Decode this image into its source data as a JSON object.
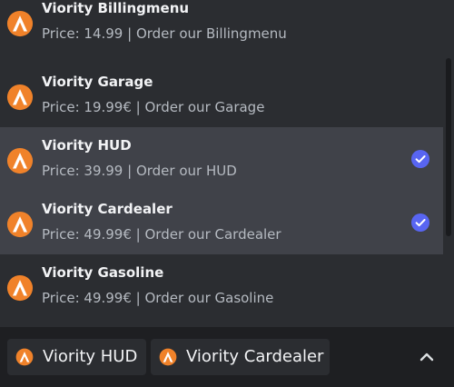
{
  "options": [
    {
      "name": "Viority Billingmenu",
      "description": "Price: 14.99 | Order our Billingmenu",
      "selected": false,
      "icon": "viority-logo-icon"
    },
    {
      "name": "Viority Garage",
      "description": "Price: 19.99€ | Order our Garage",
      "selected": false,
      "icon": "viority-logo-icon"
    },
    {
      "name": "Viority HUD",
      "description": "Price: 39.99 | Order our HUD",
      "selected": true,
      "icon": "viority-logo-icon"
    },
    {
      "name": "Viority Cardealer",
      "description": "Price: 49.99€ | Order our Cardealer",
      "selected": true,
      "icon": "viority-logo-icon"
    },
    {
      "name": "Viority Gasoline",
      "description": "Price: 49.99€ | Order our Gasoline",
      "selected": false,
      "icon": "viority-logo-icon"
    }
  ],
  "selected_chips": [
    {
      "label": "Viority HUD",
      "icon": "viority-logo-icon"
    },
    {
      "label": "Viority Cardealer",
      "icon": "viority-logo-icon"
    }
  ],
  "icons": {
    "logo": "viority-logo-icon",
    "check": "check-circle-icon",
    "caret": "chevron-up-icon"
  },
  "colors": {
    "background": "#2b2d31",
    "selected_row": "#404249",
    "bottom_bar": "#1e1f22",
    "chip": "#2b2d31",
    "check": "#5865f2",
    "logo_orange": "#f0822a",
    "title_text": "#f2f3f5",
    "description_text": "#b5bac1"
  }
}
